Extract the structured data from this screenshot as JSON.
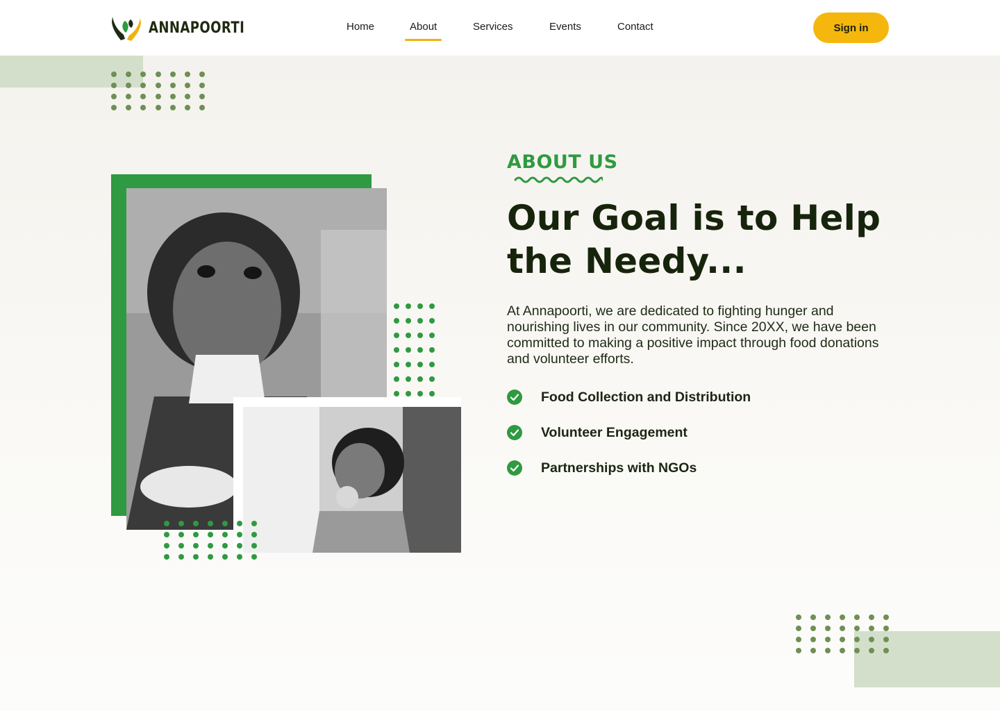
{
  "header": {
    "brand": "ANNAPOORTI",
    "logo_icon": "hands-leaf-icon",
    "nav": [
      {
        "label": "Home",
        "active": false
      },
      {
        "label": "About",
        "active": true
      },
      {
        "label": "Services",
        "active": false
      },
      {
        "label": "Events",
        "active": false
      },
      {
        "label": "Contact",
        "active": false
      }
    ],
    "signin_label": "Sign in"
  },
  "about": {
    "eyebrow": "ABOUT US",
    "headline": "Our Goal is to Help the Needy...",
    "description": "At Annapoorti, we are dedicated to fighting hunger and nourishing lives in our community. Since 20XX, we have been committed to making a positive impact through food donations and volunteer efforts.",
    "features": [
      {
        "label": "Food Collection and Distribution",
        "icon": "check-circle-icon"
      },
      {
        "label": "Volunteer Engagement",
        "icon": "check-circle-icon"
      },
      {
        "label": "Partnerships with NGOs",
        "icon": "check-circle-icon"
      }
    ]
  },
  "images": {
    "main_photo": "child-portrait-photo",
    "secondary_photo": "child-eating-photo"
  },
  "colors": {
    "accent_green": "#2f9a41",
    "accent_yellow": "#f5b70d",
    "dark_text": "#17240c",
    "deco_sage": "#d4dfcb",
    "dot_olive": "#6f8f55"
  }
}
